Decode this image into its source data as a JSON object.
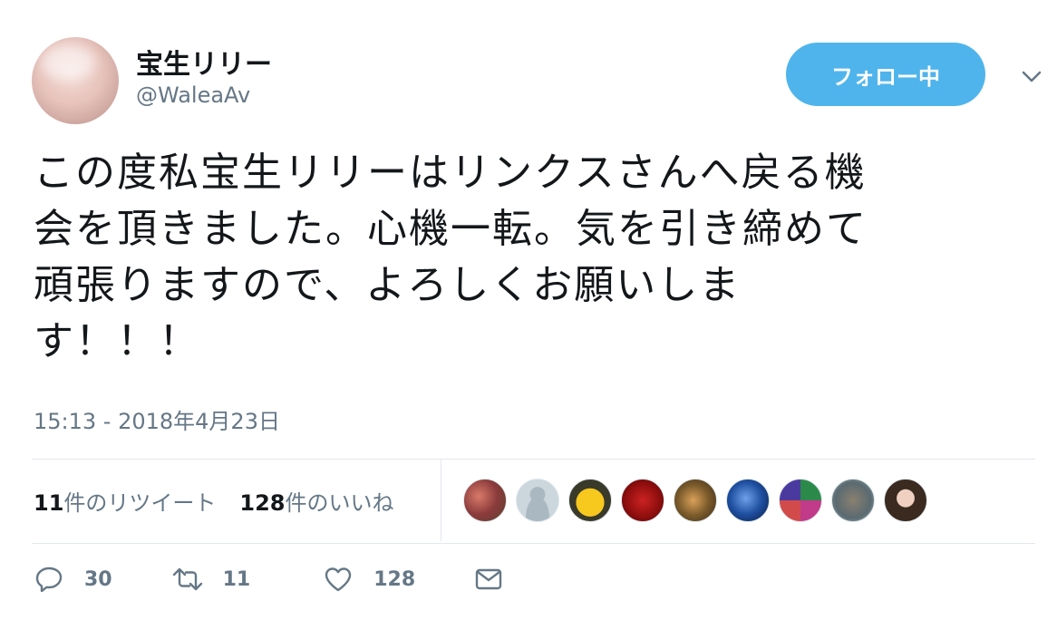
{
  "user": {
    "display_name": "宝生リリー",
    "handle": "@WaleaAv"
  },
  "follow_button_label": "フォロー中",
  "tweet": {
    "text": "この度私宝生リリーはリンクスさんへ戻る機\n会を頂きました。心機一転。気を引き締めて\n頑張りますので、よろしくお願いしま\nす！！！",
    "timestamp": "15:13 - 2018年4月23日"
  },
  "stats": {
    "retweet_count": "11",
    "retweet_label": "件のリツイート",
    "like_count": "128",
    "like_label": "件のいいね"
  },
  "likers_icons": [
    "liker-avatar-couple",
    "liker-avatar-default",
    "liker-avatar-duck",
    "liker-avatar-red",
    "liker-avatar-food",
    "liker-avatar-blue",
    "liker-avatar-pattern",
    "liker-avatar-cat",
    "liker-avatar-woman"
  ],
  "actions": {
    "reply_count": "30",
    "retweet_count": "11",
    "like_count": "128"
  },
  "colors": {
    "accent": "#4fb4ec",
    "secondary_text": "#657786"
  }
}
